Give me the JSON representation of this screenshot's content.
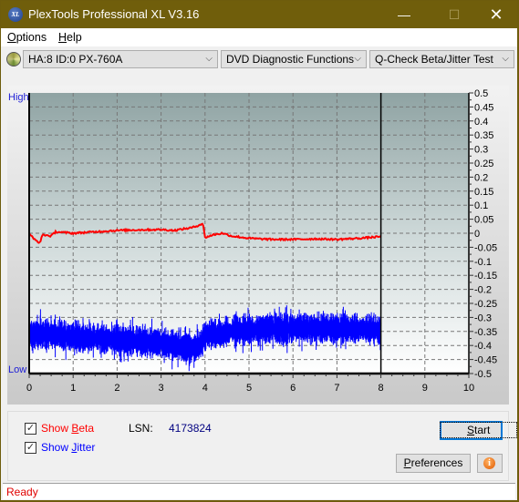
{
  "window": {
    "title": "PlexTools Professional XL V3.16",
    "app_icon_text": "XL",
    "controls": {
      "minimize": "—",
      "maximize": "☐",
      "close": "✕"
    }
  },
  "menubar": {
    "items": [
      {
        "label": "Options",
        "accel": "O",
        "rest": "ptions"
      },
      {
        "label": "Help",
        "accel": "H",
        "rest": "elp"
      }
    ]
  },
  "toolbar": {
    "drive": "HA:8 ID:0  PX-760A",
    "function": "DVD Diagnostic Functions",
    "test": "Q-Check Beta/Jitter Test",
    "chevron": "⌵"
  },
  "chart": {
    "label_high": "High",
    "label_low": "Low"
  },
  "chart_data": {
    "type": "line",
    "title": "",
    "xlabel": "",
    "ylabel": "",
    "x_range": [
      0,
      10
    ],
    "y_right_range": [
      -0.5,
      0.5
    ],
    "x_ticks": [
      0,
      1,
      2,
      3,
      4,
      5,
      6,
      7,
      8,
      9,
      10
    ],
    "y_ticks": [
      0.5,
      0.45,
      0.4,
      0.35,
      0.3,
      0.25,
      0.2,
      0.15,
      0.1,
      0.05,
      0,
      -0.05,
      -0.1,
      -0.15,
      -0.2,
      -0.25,
      -0.3,
      -0.35,
      -0.4,
      -0.45,
      -0.5
    ],
    "y_tick_labels": [
      "0.5",
      "0.45",
      "0.4",
      "0.35",
      "0.3",
      "0.25",
      "0.2",
      "0.15",
      "0.1",
      "0.05",
      "0",
      "-0.05",
      "-0.1",
      "-0.15",
      "-0.2",
      "-0.25",
      "-0.3",
      "-0.35",
      "-0.4",
      "-0.45",
      "-0.5"
    ],
    "left_axis_labels": [
      "High",
      "Low"
    ],
    "grid": true,
    "end_marker_x": 8,
    "series": [
      {
        "name": "Beta",
        "color": "#ff0000",
        "x": [
          0,
          0.1,
          0.2,
          0.25,
          0.3,
          0.5,
          0.6,
          1.0,
          1.5,
          2.0,
          2.5,
          3.0,
          3.3,
          3.5,
          3.7,
          3.8,
          3.95,
          4.0,
          4.2,
          4.4,
          4.6,
          5.0,
          5.5,
          6.0,
          6.5,
          7.0,
          7.5,
          8.0
        ],
        "values": [
          0.0,
          -0.02,
          -0.03,
          -0.035,
          -0.005,
          -0.01,
          0.005,
          0.0,
          0.005,
          0.01,
          0.012,
          0.013,
          0.01,
          0.015,
          0.02,
          0.025,
          0.035,
          -0.015,
          -0.005,
          0.0,
          -0.01,
          -0.018,
          -0.022,
          -0.022,
          -0.02,
          -0.022,
          -0.018,
          -0.012
        ]
      },
      {
        "name": "Jitter",
        "color": "#0000ff",
        "x": [
          0,
          0.5,
          1.0,
          1.5,
          2.0,
          2.5,
          3.0,
          3.3,
          3.6,
          3.9,
          4.0,
          4.3,
          4.6,
          5.0,
          5.5,
          6.0,
          6.5,
          7.0,
          7.5,
          8.0
        ],
        "values": [
          -0.36,
          -0.36,
          -0.37,
          -0.375,
          -0.38,
          -0.385,
          -0.39,
          -0.4,
          -0.41,
          -0.4,
          -0.36,
          -0.36,
          -0.35,
          -0.345,
          -0.34,
          -0.34,
          -0.34,
          -0.34,
          -0.34,
          -0.345
        ],
        "spread": 0.04
      }
    ]
  },
  "controls": {
    "show_beta": {
      "label": "Show Beta",
      "pre": "Show ",
      "accel": "B",
      "rest": "eta",
      "checked": true,
      "color": "#ff0000"
    },
    "show_jitter": {
      "label": "Show Jitter",
      "pre": "Show ",
      "accel": "J",
      "rest": "itter",
      "checked": true,
      "color": "#0000ff"
    },
    "lsn_label": "LSN:",
    "lsn_value": "4173824",
    "start_button": {
      "accel": "S",
      "rest": "tart"
    },
    "preferences_button": {
      "accel": "P",
      "rest": "references"
    },
    "info_button": "i"
  },
  "status": {
    "text": "Ready"
  }
}
